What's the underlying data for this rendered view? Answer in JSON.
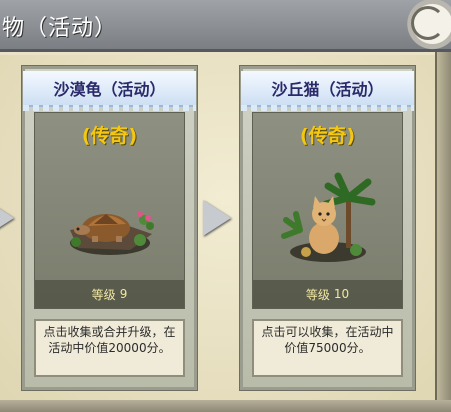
{
  "banner": {
    "title": "物（活动）"
  },
  "cards": [
    {
      "title": "沙漠龟（活动）",
      "rarity": "(传奇)",
      "level_label": "等级",
      "level_value": "9",
      "description": "点击收集或合并升级，在活动中价值20000分。",
      "creature_icon": "desert-tortoise-icon"
    },
    {
      "title": "沙丘猫（活动）",
      "rarity": "(传奇)",
      "level_label": "等级",
      "level_value": "10",
      "description": "点击可以收集，在活动中价值75000分。",
      "creature_icon": "sand-cat-icon"
    }
  ],
  "colors": {
    "rarity": "#f3c712",
    "banner": "#8b8f93",
    "parchment": "#e9e2c6"
  }
}
